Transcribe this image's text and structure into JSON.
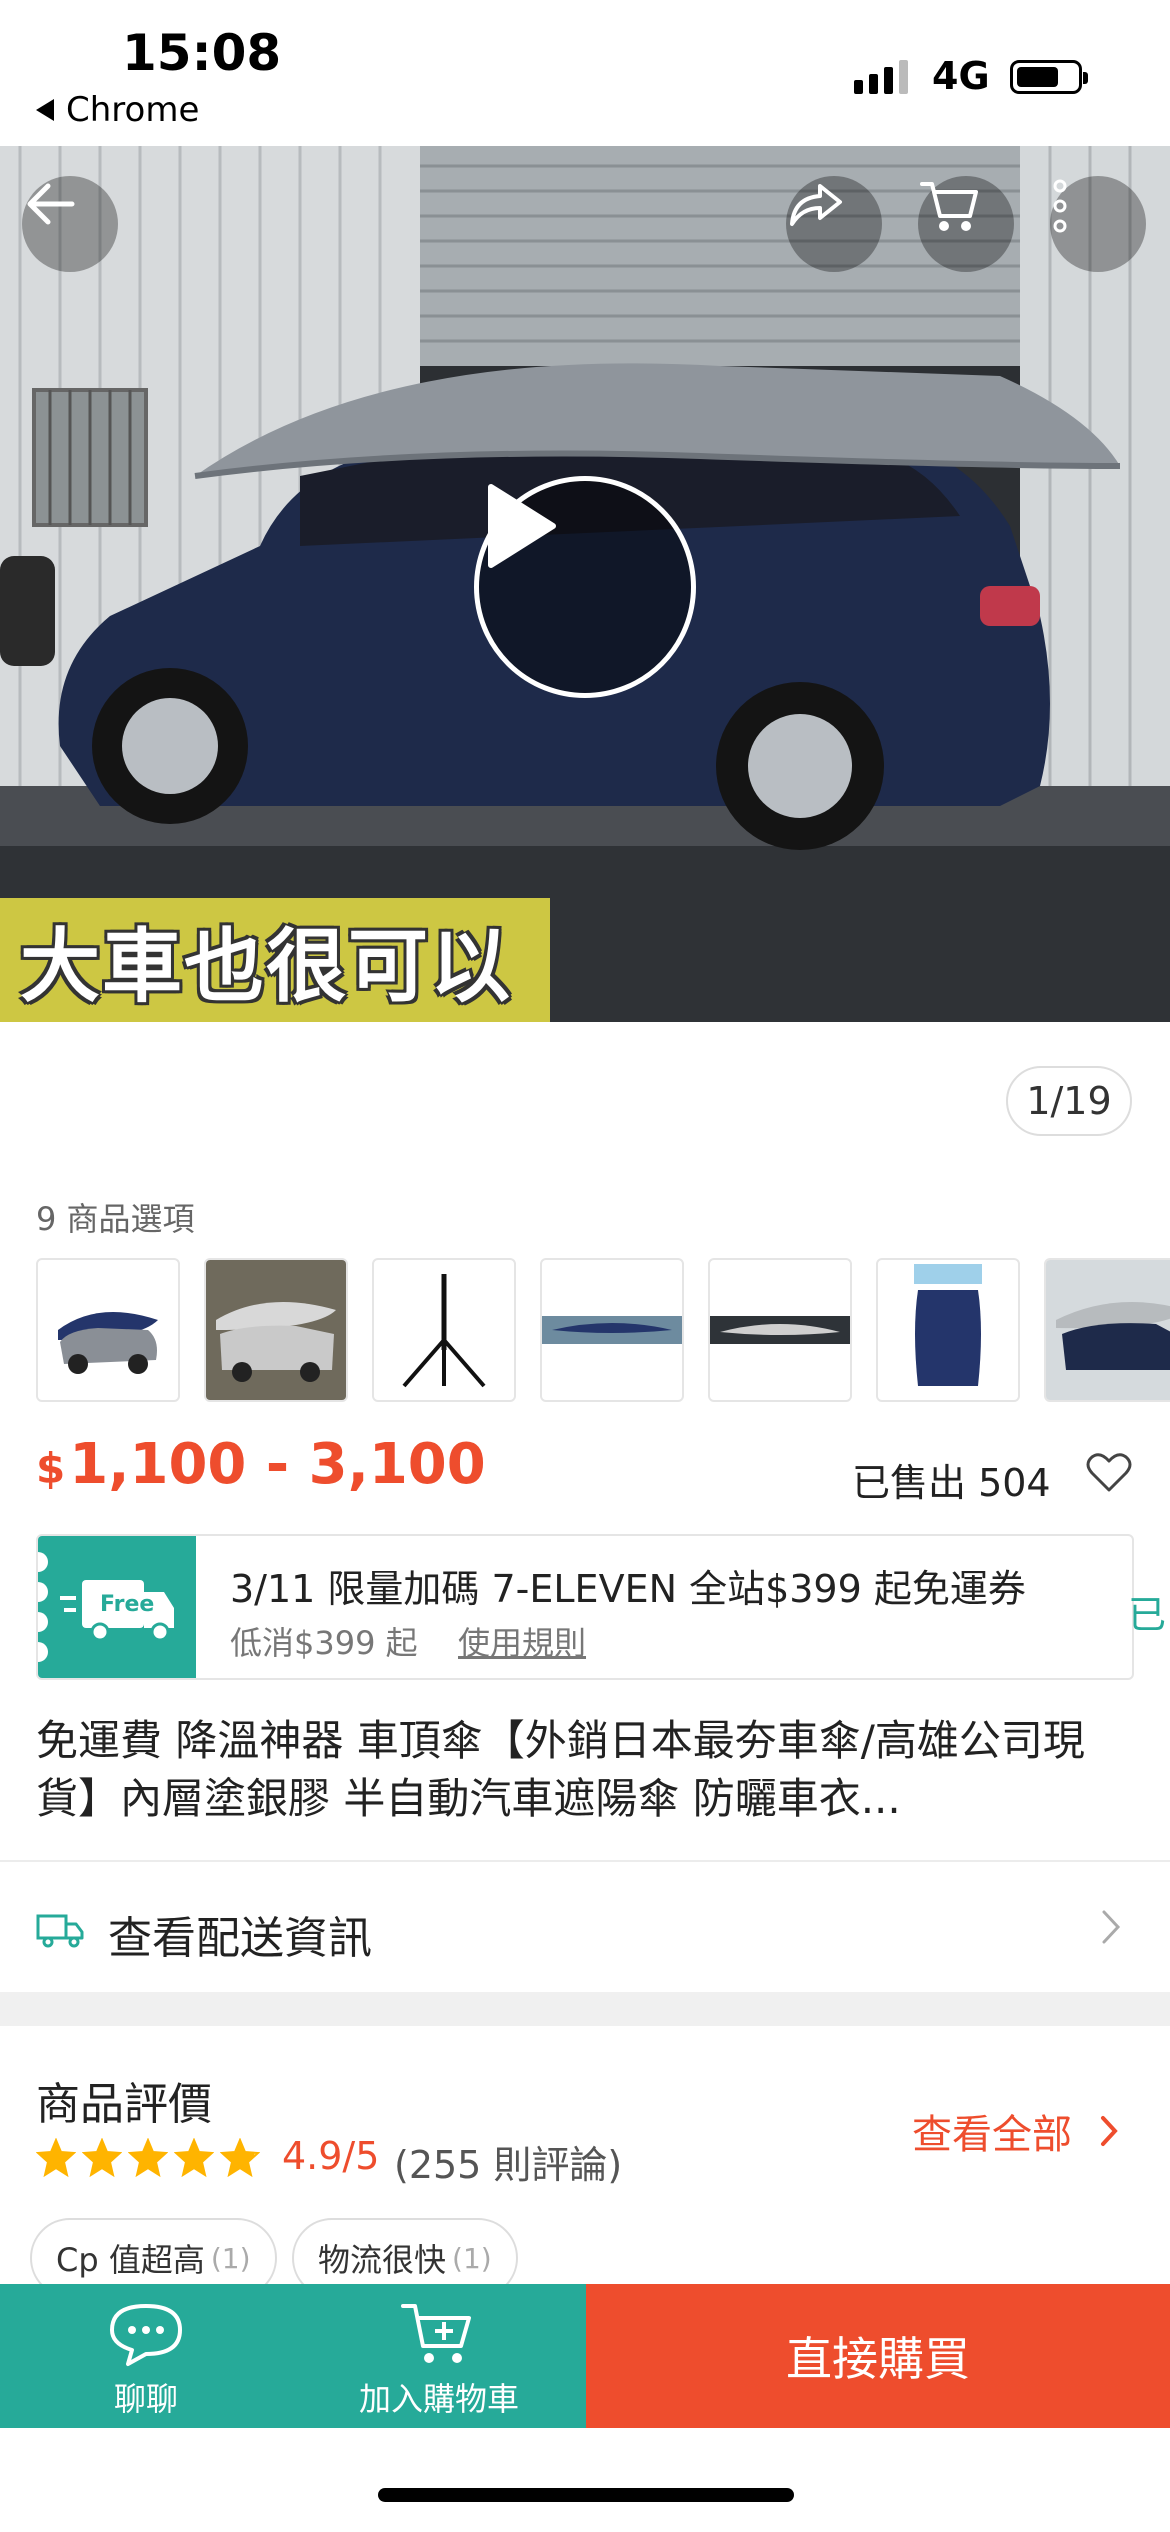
{
  "status_bar": {
    "time": "15:08",
    "back_app": "Chrome",
    "network": "4G"
  },
  "hero": {
    "caption": "大車也很可以",
    "counter": "1/19"
  },
  "options": {
    "label": "9 商品選項"
  },
  "price": {
    "currency": "$",
    "range": "1,100 - 3,100"
  },
  "sold": "已售出 504",
  "voucher": {
    "badge": "Free",
    "title": "3/11 限量加碼 7-ELEVEN 全站$399 起免運券",
    "min_spend": "低消$399 起",
    "rules_link": "使用規則",
    "overflow_text": "已"
  },
  "product_title": "免運費 降溫神器 車頂傘【外銷日本最夯車傘/高雄公司現貨】內層塗銀膠 半自動汽車遮陽傘 防曬車衣...",
  "shipping": {
    "label": "查看配送資訊"
  },
  "ratings": {
    "title": "商品評價",
    "score": "4.9/5",
    "count": "(255 則評論)",
    "see_all": "查看全部",
    "stars_value": 4.9,
    "tags": [
      {
        "label": "Cp 值超高",
        "count": "(1)"
      },
      {
        "label": "物流很快",
        "count": "(1)"
      }
    ]
  },
  "bottom_bar": {
    "chat": "聊聊",
    "add_to_cart": "加入購物車",
    "buy_now": "直接購買"
  },
  "colors": {
    "brand_orange": "#ee4d2d",
    "brand_teal": "#26aa99"
  },
  "icons": [
    "back-arrow-icon",
    "share-icon",
    "cart-icon",
    "more-icon",
    "play-icon",
    "heart-icon",
    "truck-icon",
    "chevron-right-icon",
    "star-icon",
    "chat-icon",
    "add-cart-icon"
  ]
}
